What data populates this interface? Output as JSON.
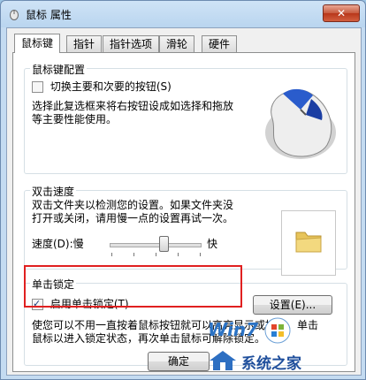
{
  "window": {
    "title": "鼠标 属性",
    "close_label": "✕"
  },
  "tabs": [
    {
      "label": "鼠标键",
      "active": true
    },
    {
      "label": "指针"
    },
    {
      "label": "指针选项"
    },
    {
      "label": "滑轮"
    },
    {
      "label": "硬件"
    }
  ],
  "button_config": {
    "title": "鼠标键配置",
    "checkbox_label": "切换主要和次要的按钮(S)",
    "checked": false,
    "desc_line1": "选择此复选框来将右按钮设成如选择和拖放",
    "desc_line2": "等主要性能使用。"
  },
  "double_click": {
    "title": "双击速度",
    "desc_line1": "双击文件夹以检测您的设置。如果文件夹没",
    "desc_line2": "打开或关闭，请用慢一点的设置再试一次。",
    "speed_label": "速度(D):慢",
    "fast_label": "快",
    "speed_level": 0.6
  },
  "click_lock": {
    "title": "单击锁定",
    "checkbox_label": "启用单击锁定(T)",
    "checked": true,
    "settings_button": "设置(E)...",
    "desc_line1": "使您可以不用一直按着鼠标按钮就可以高亮显示或拖拽。单击",
    "desc_line2": "鼠标以进入锁定状态，再次单击鼠标可解除锁定。"
  },
  "footer": {
    "ok_label": "确定"
  },
  "watermark": {
    "brand": "Win7",
    "site": "系统之家"
  }
}
